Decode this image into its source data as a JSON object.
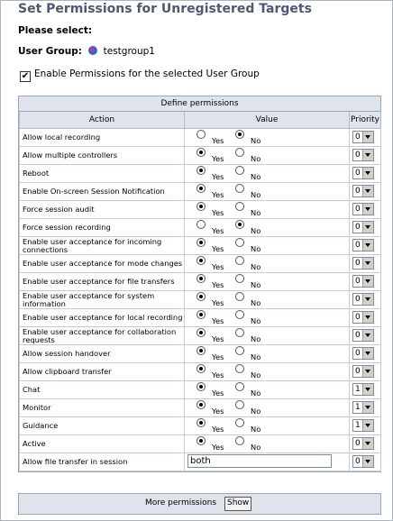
{
  "title": "Set Permissions for Unregistered Targets",
  "please_select": "Please select:",
  "user_group": {
    "label": "User Group:",
    "value": "testgroup1"
  },
  "enable_checkbox": {
    "label": "Enable Permissions for the selected User Group",
    "checked": true,
    "mark": "✔"
  },
  "permissions": {
    "heading": "Define permissions",
    "columns": {
      "action": "Action",
      "value": "Value",
      "priority": "Priority"
    },
    "yes_label": "Yes",
    "no_label": "No",
    "rows": [
      {
        "action": "Allow local recording",
        "value": "No",
        "priority": "0"
      },
      {
        "action": "Allow multiple controllers",
        "value": "Yes",
        "priority": "0"
      },
      {
        "action": "Reboot",
        "value": "Yes",
        "priority": "0"
      },
      {
        "action": "Enable On-screen Session Notification",
        "value": "Yes",
        "priority": "0"
      },
      {
        "action": "Force session audit",
        "value": "Yes",
        "priority": "0"
      },
      {
        "action": "Force session recording",
        "value": "No",
        "priority": "0"
      },
      {
        "action": "Enable user acceptance for incoming connections",
        "value": "Yes",
        "priority": "0"
      },
      {
        "action": "Enable user acceptance for mode changes",
        "value": "Yes",
        "priority": "0"
      },
      {
        "action": "Enable user acceptance for file transfers",
        "value": "Yes",
        "priority": "0"
      },
      {
        "action": "Enable user acceptance for system information",
        "value": "Yes",
        "priority": "0"
      },
      {
        "action": "Enable user acceptance for local recording",
        "value": "Yes",
        "priority": "0"
      },
      {
        "action": "Enable user acceptance for collaboration requests",
        "value": "Yes",
        "priority": "0"
      },
      {
        "action": "Allow session handover",
        "value": "Yes",
        "priority": "0"
      },
      {
        "action": "Allow clipboard transfer",
        "value": "Yes",
        "priority": "0"
      },
      {
        "action": "Chat",
        "value": "Yes",
        "priority": "1"
      },
      {
        "action": "Monitor",
        "value": "Yes",
        "priority": "1"
      },
      {
        "action": "Guidance",
        "value": "Yes",
        "priority": "1"
      },
      {
        "action": "Active",
        "value": "Yes",
        "priority": "0"
      }
    ],
    "file_transfer": {
      "action": "Allow file transfer in session",
      "value": "both",
      "priority": "0"
    }
  },
  "more": {
    "label": "More permissions",
    "button": "Show"
  }
}
